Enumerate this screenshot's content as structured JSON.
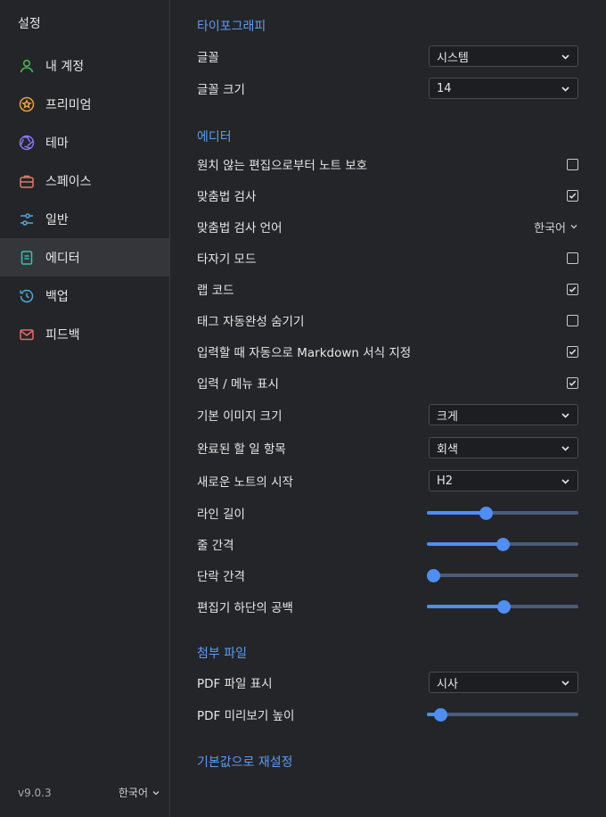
{
  "sidebar": {
    "title": "설정",
    "items": [
      {
        "label": "내 계정",
        "icon": "user-icon",
        "color": "#3fb950"
      },
      {
        "label": "프리미엄",
        "icon": "star-badge-icon",
        "color": "#f0a030"
      },
      {
        "label": "테마",
        "icon": "aperture-icon",
        "color": "#8b7cf6"
      },
      {
        "label": "스페이스",
        "icon": "briefcase-icon",
        "color": "#e07b67"
      },
      {
        "label": "일반",
        "icon": "sliders-icon",
        "color": "#4ea8de"
      },
      {
        "label": "에디터",
        "icon": "document-icon",
        "color": "#2ec4b6"
      },
      {
        "label": "백업",
        "icon": "history-icon",
        "color": "#4ea8de"
      },
      {
        "label": "피드백",
        "icon": "mail-icon",
        "color": "#e86a6a"
      }
    ],
    "active_index": 5,
    "version": "v9.0.3",
    "language": "한국어"
  },
  "typography": {
    "title": "타이포그래피",
    "font_label": "글꼴",
    "font_value": "시스템",
    "font_size_label": "글꼴 크기",
    "font_size_value": "14"
  },
  "editor": {
    "title": "에디터",
    "items": [
      {
        "label": "원치 않는 편집으로부터 노트 보호",
        "checked": false
      },
      {
        "label": "맞춤법 검사",
        "checked": true
      },
      {
        "label": "맞춤법 검사 언어",
        "value": "한국어"
      },
      {
        "label": "타자기 모드",
        "checked": false
      },
      {
        "label": "랩 코드",
        "checked": true
      },
      {
        "label": "태그 자동완성 숨기기",
        "checked": false
      },
      {
        "label": "입력할 때 자동으로 Markdown 서식 지정",
        "checked": true
      },
      {
        "label": "입력 / 메뉴 표시",
        "checked": true
      }
    ],
    "image_size_label": "기본 이미지 크기",
    "image_size_value": "크게",
    "done_items_label": "완료된 할 일 항목",
    "done_items_value": "회색",
    "new_note_label": "새로운 노트의 시작",
    "new_note_value": "H2",
    "line_width_label": "라인 길이",
    "line_width_level": 0.38,
    "line_spacing_label": "줄 간격",
    "line_spacing_level": 0.5,
    "paragraph_spacing_label": "단락 간격",
    "paragraph_spacing_level": 0.0,
    "bottom_space_label": "편집기 하단의 공백",
    "bottom_space_level": 0.51
  },
  "attachments": {
    "title": "첨부 파일",
    "pdf_display_label": "PDF 파일 표시",
    "pdf_display_value": "시사",
    "pdf_preview_label": "PDF 미리보기 높이",
    "pdf_preview_level": 0.05
  },
  "reset_label": "기본값으로 재설정"
}
